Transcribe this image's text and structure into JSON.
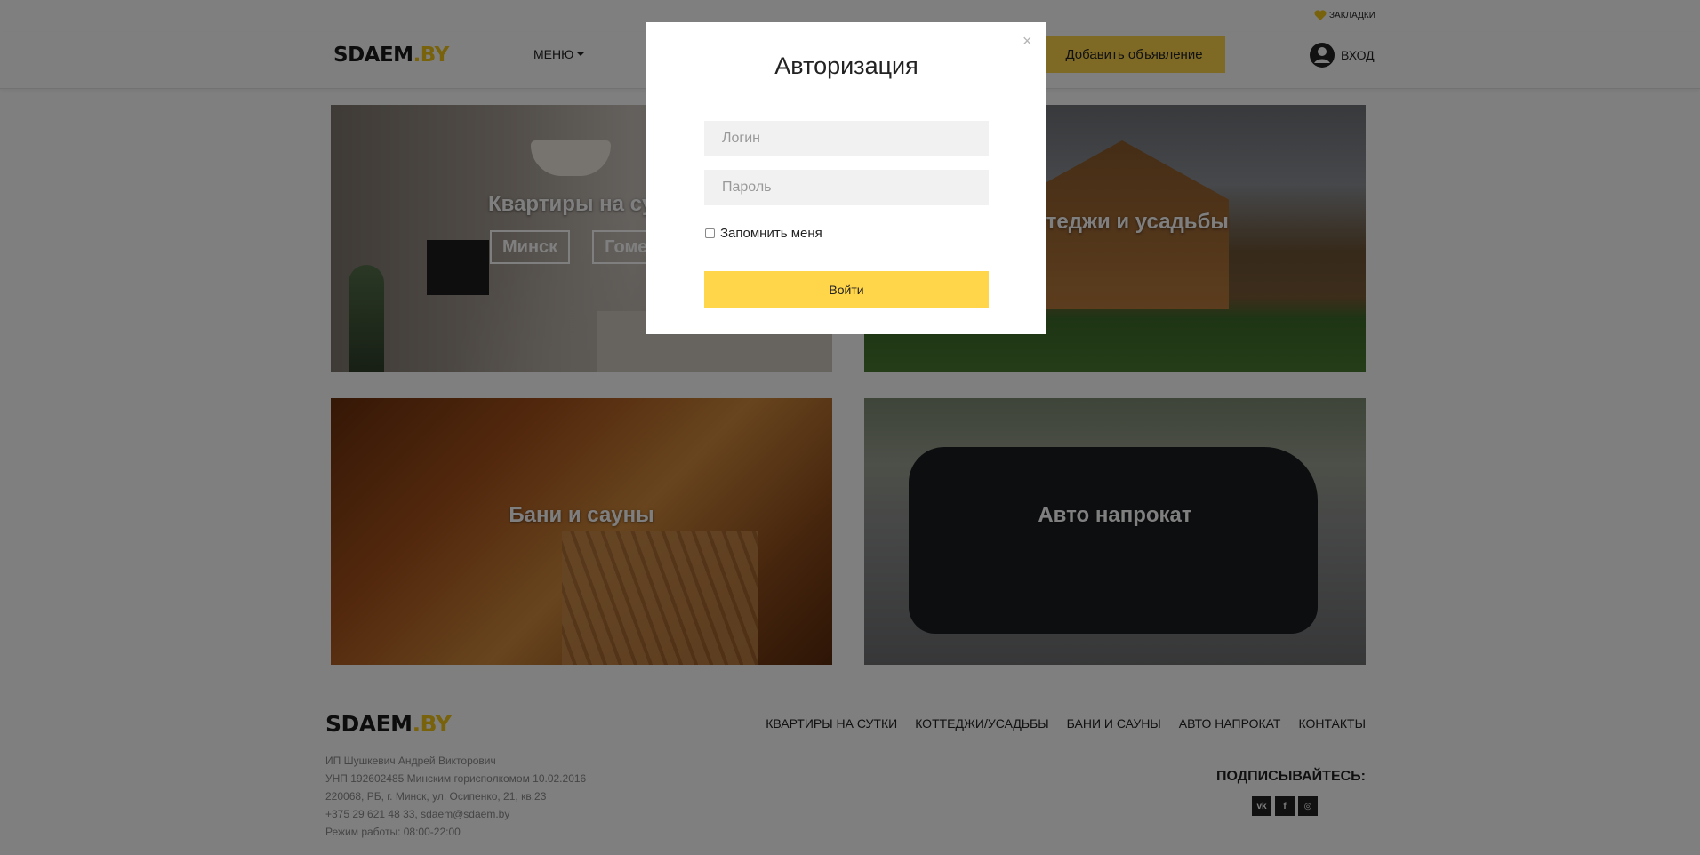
{
  "colors": {
    "accent": "#ffd54a",
    "brand_by": "#f0c419",
    "overlay": "rgba(0,0,0,0.5)"
  },
  "topbar": {
    "bookmarks_label": "ЗАКЛАДКИ",
    "bookmarks_icon": "heart-icon"
  },
  "header": {
    "logo_main": "SDAEM",
    "logo_tld": ".BY",
    "menu_label": "МЕНЮ",
    "add_listing_label": "Добавить объявление",
    "login_label": "ВХОД",
    "login_icon": "user-icon"
  },
  "tiles": {
    "apartments": {
      "title": "Квартиры на сутки",
      "cities": [
        "Минск",
        "Гомель"
      ]
    },
    "cottages": {
      "title": "Коттеджи и усадьбы"
    },
    "sauna": {
      "title": "Бани и сауны"
    },
    "auto": {
      "title": "Авто напрокат"
    }
  },
  "footer": {
    "logo_main": "SDAEM",
    "logo_tld": ".BY",
    "info": [
      "ИП Шушкевич Андрей Викторович",
      "УНП 192602485 Минским горисполкомом 10.02.2016",
      "220068, РБ, г. Минск, ул. Осипенко, 21, кв.23",
      "+375 29 621 48 33, sdaem@sdaem.by",
      "Режим работы: 08:00-22:00"
    ],
    "nav": [
      "КВАРТИРЫ НА СУТКИ",
      "КОТТЕДЖИ/УСАДЬБЫ",
      "БАНИ И САУНЫ",
      "АВТО НАПРОКАТ",
      "КОНТАКТЫ"
    ],
    "subscribe_label": "ПОДПИСЫВАЙТЕСЬ:",
    "socials": [
      {
        "icon": "vk-icon",
        "glyph": "vk"
      },
      {
        "icon": "facebook-icon",
        "glyph": "f"
      },
      {
        "icon": "instagram-icon",
        "glyph": "◎"
      }
    ]
  },
  "modal": {
    "title": "Авторизация",
    "close_glyph": "×",
    "login_placeholder": "Логин",
    "password_placeholder": "Пароль",
    "remember_label": "Запомнить меня",
    "remember_checked": false,
    "submit_label": "Войти"
  }
}
